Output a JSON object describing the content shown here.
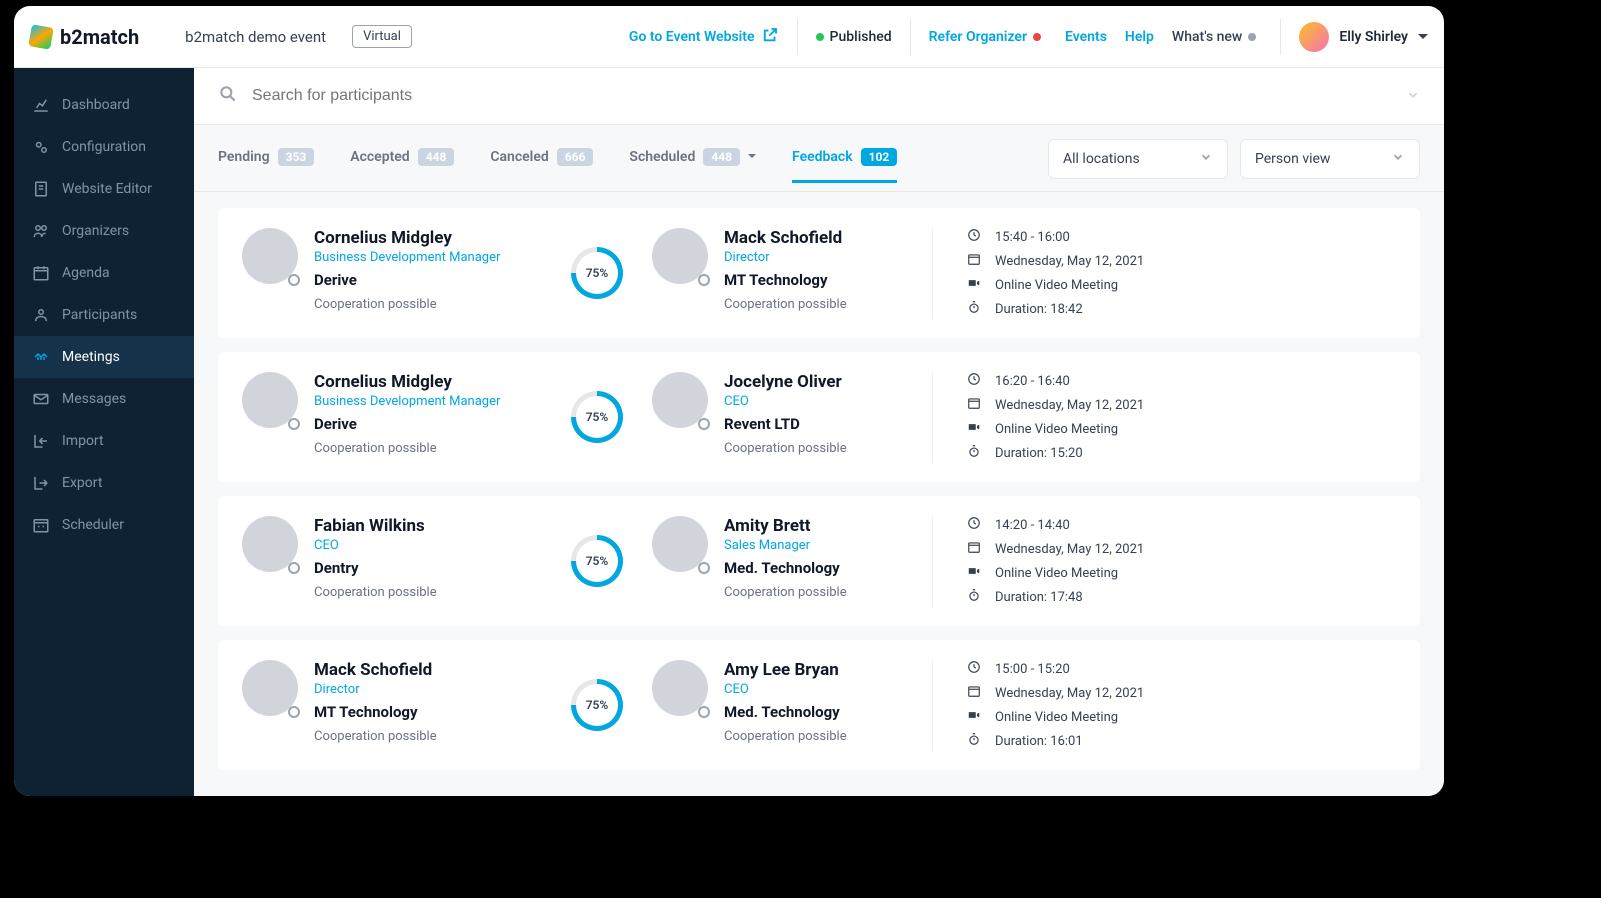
{
  "brand": "b2match",
  "event_name": "b2match demo event",
  "virtual_badge": "Virtual",
  "header": {
    "goto": "Go to Event Website",
    "published": "Published",
    "refer": "Refer Organizer",
    "events": "Events",
    "help": "Help",
    "whatsnew": "What's new",
    "user": "Elly Shirley"
  },
  "sidebar": {
    "items": [
      {
        "label": "Dashboard",
        "icon": "chart"
      },
      {
        "label": "Configuration",
        "icon": "gears"
      },
      {
        "label": "Website Editor",
        "icon": "doc"
      },
      {
        "label": "Organizers",
        "icon": "users"
      },
      {
        "label": "Agenda",
        "icon": "calendar"
      },
      {
        "label": "Participants",
        "icon": "people"
      },
      {
        "label": "Meetings",
        "icon": "handshake",
        "active": true
      },
      {
        "label": "Messages",
        "icon": "mail"
      },
      {
        "label": "Import",
        "icon": "import"
      },
      {
        "label": "Export",
        "icon": "export"
      },
      {
        "label": "Scheduler",
        "icon": "sched"
      }
    ]
  },
  "search": {
    "placeholder": "Search for participants"
  },
  "tabs": [
    {
      "label": "Pending",
      "count": "353"
    },
    {
      "label": "Accepted",
      "count": "448"
    },
    {
      "label": "Canceled",
      "count": "666"
    },
    {
      "label": "Scheduled",
      "count": "448",
      "caret": true
    },
    {
      "label": "Feedback",
      "count": "102",
      "active": true
    }
  ],
  "filters": {
    "location": "All locations",
    "view": "Person view"
  },
  "meetings": [
    {
      "a": {
        "name": "Cornelius Midgley",
        "role": "Business Development Manager",
        "company": "Derive",
        "coop": "Cooperation possible",
        "av": "av1"
      },
      "pct": "75%",
      "b": {
        "name": "Mack Schofield",
        "role": "Director",
        "company": "MT Technology",
        "coop": "Cooperation possible",
        "av": "av2"
      },
      "meta": {
        "time": "15:40 - 16:00",
        "date": "Wednesday, May 12, 2021",
        "mode": "Online Video Meeting",
        "duration": "Duration: 18:42"
      }
    },
    {
      "a": {
        "name": "Cornelius Midgley",
        "role": "Business Development Manager",
        "company": "Derive",
        "coop": "Cooperation possible",
        "av": "av1"
      },
      "pct": "75%",
      "b": {
        "name": "Jocelyne Oliver",
        "role": "CEO",
        "company": "Revent LTD",
        "coop": "Cooperation possible",
        "av": "av3"
      },
      "meta": {
        "time": "16:20 - 16:40",
        "date": "Wednesday, May 12, 2021",
        "mode": "Online Video Meeting",
        "duration": "Duration: 15:20"
      }
    },
    {
      "a": {
        "name": "Fabian Wilkins",
        "role": "CEO",
        "company": "Dentry",
        "coop": "Cooperation possible",
        "av": "av4"
      },
      "pct": "75%",
      "b": {
        "name": "Amity Brett",
        "role": "Sales Manager",
        "company": "Med. Technology",
        "coop": "Cooperation possible",
        "av": "av5"
      },
      "meta": {
        "time": "14:20 - 14:40",
        "date": "Wednesday, May 12, 2021",
        "mode": "Online Video Meeting",
        "duration": "Duration: 17:48"
      }
    },
    {
      "a": {
        "name": "Mack Schofield",
        "role": "Director",
        "company": "MT Technology",
        "coop": "Cooperation possible",
        "av": "av2"
      },
      "pct": "75%",
      "b": {
        "name": "Amy Lee Bryan",
        "role": "CEO",
        "company": "Med. Technology",
        "coop": "Cooperation possible",
        "av": "av6"
      },
      "meta": {
        "time": "15:00 - 15:20",
        "date": "Wednesday, May 12, 2021",
        "mode": "Online Video Meeting",
        "duration": "Duration: 16:01"
      }
    }
  ]
}
